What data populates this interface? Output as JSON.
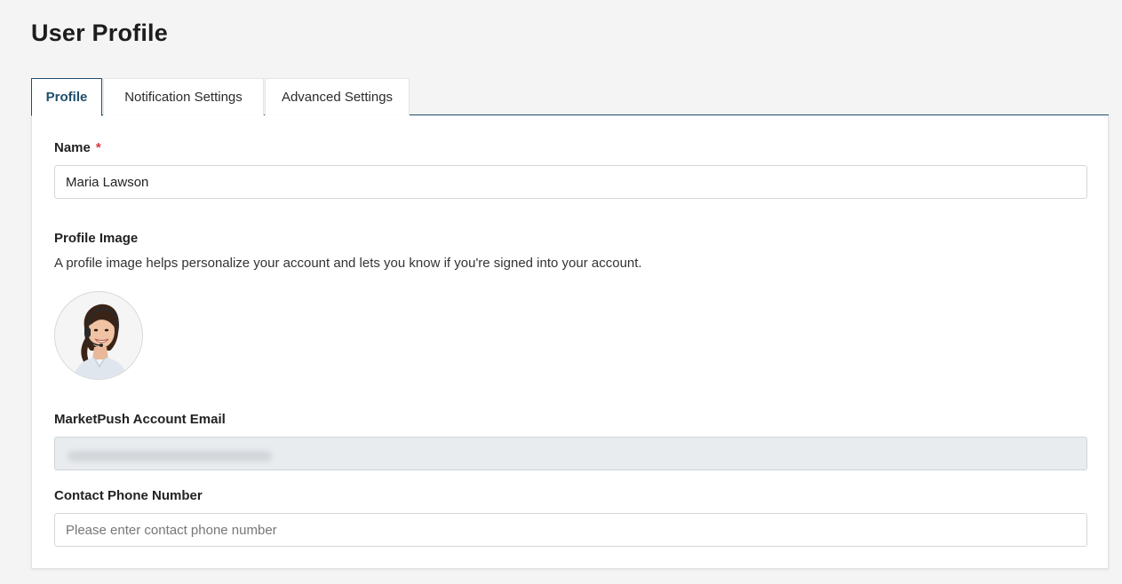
{
  "page": {
    "title": "User Profile"
  },
  "tabs": [
    {
      "label": "Profile",
      "active": true
    },
    {
      "label": "Notification Settings",
      "active": false
    },
    {
      "label": "Advanced Settings",
      "active": false
    }
  ],
  "form": {
    "name": {
      "label": "Name",
      "required_marker": "*",
      "value": "Maria Lawson"
    },
    "profile_image": {
      "label": "Profile Image",
      "help": "A profile image helps personalize your account and lets you know if you're signed into your account.",
      "icon": "user-avatar-icon"
    },
    "email": {
      "label": "MarketPush Account Email",
      "value": ""
    },
    "phone": {
      "label": "Contact Phone Number",
      "value": "",
      "placeholder": "Please enter contact phone number"
    }
  },
  "colors": {
    "accent": "#1f4e6b",
    "required": "#d9363e",
    "page_background": "#f4f4f4",
    "disabled_input": "#e9ecef"
  }
}
